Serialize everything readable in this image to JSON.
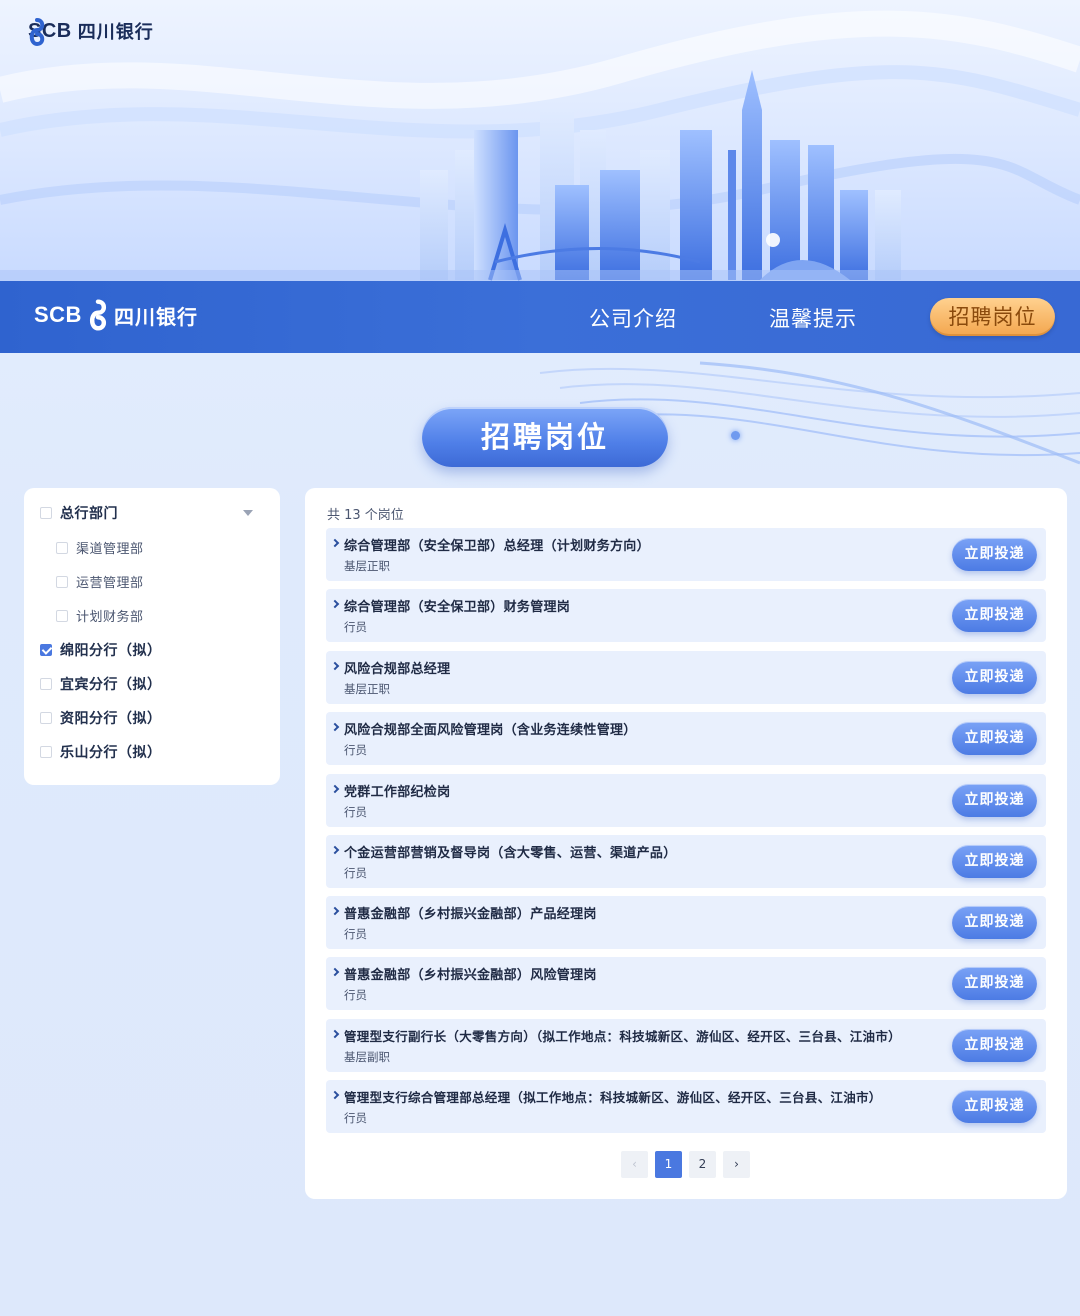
{
  "brand": {
    "latin": "SCB",
    "cn": "四川银行"
  },
  "nav": {
    "items": [
      {
        "label": "公司介绍"
      },
      {
        "label": "温馨提示"
      },
      {
        "label": "招聘岗位",
        "active": true
      }
    ]
  },
  "section_title": "招聘岗位",
  "filters": [
    {
      "label": "总行部门",
      "checked": false,
      "level": 1,
      "expandable": true
    },
    {
      "label": "渠道管理部",
      "checked": false,
      "level": 2
    },
    {
      "label": "运营管理部",
      "checked": false,
      "level": 2
    },
    {
      "label": "计划财务部",
      "checked": false,
      "level": 2
    },
    {
      "label": "绵阳分行（拟）",
      "checked": true,
      "level": 1
    },
    {
      "label": "宜宾分行（拟）",
      "checked": false,
      "level": 1
    },
    {
      "label": "资阳分行（拟）",
      "checked": false,
      "level": 1
    },
    {
      "label": "乐山分行（拟）",
      "checked": false,
      "level": 1
    }
  ],
  "jobs": {
    "count_text": "共 13 个岗位",
    "apply_label": "立即投递",
    "items": [
      {
        "title": "综合管理部（安全保卫部）总经理（计划财务方向）",
        "level": "基层正职"
      },
      {
        "title": "综合管理部（安全保卫部）财务管理岗",
        "level": "行员"
      },
      {
        "title": "风险合规部总经理",
        "level": "基层正职"
      },
      {
        "title": "风险合规部全面风险管理岗（含业务连续性管理）",
        "level": "行员"
      },
      {
        "title": "党群工作部纪检岗",
        "level": "行员"
      },
      {
        "title": "个金运营部营销及督导岗（含大零售、运营、渠道产品）",
        "level": "行员"
      },
      {
        "title": "普惠金融部（乡村振兴金融部）产品经理岗",
        "level": "行员"
      },
      {
        "title": "普惠金融部（乡村振兴金融部）风险管理岗",
        "level": "行员"
      },
      {
        "title": "管理型支行副行长（大零售方向）（拟工作地点：科技城新区、游仙区、经开区、三台县、江油市）",
        "level": "基层副职"
      },
      {
        "title": "管理型支行综合管理部总经理（拟工作地点：科技城新区、游仙区、经开区、三台县、江油市）",
        "level": "行员"
      }
    ]
  },
  "pagination": {
    "prev": "‹",
    "pages": [
      "1",
      "2"
    ],
    "current": "1",
    "next": "›"
  },
  "colors": {
    "primary": "#3b6fd8",
    "accent_orange": "#f3a64e",
    "card_bg": "#e9f0fd"
  }
}
